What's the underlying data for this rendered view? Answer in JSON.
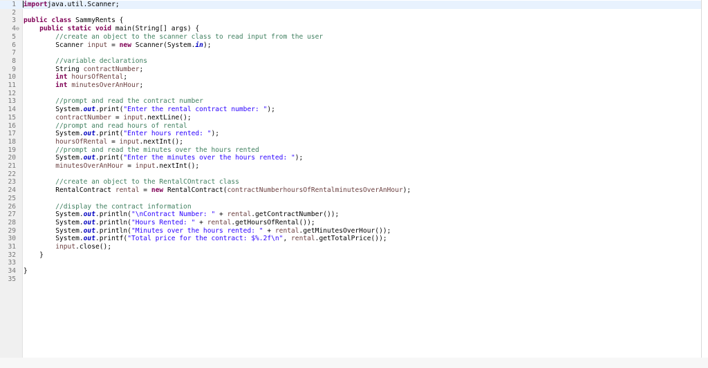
{
  "editor": {
    "lines": [
      {
        "n": "1",
        "tokens": [
          [
            "kw",
            "import"
          ],
          [
            "",
            "java.util.Scanner;"
          ]
        ]
      },
      {
        "n": "2",
        "tokens": []
      },
      {
        "n": "3",
        "tokens": [
          [
            "kw",
            "public"
          ],
          [
            "",
            " "
          ],
          [
            "kw",
            "class"
          ],
          [
            "",
            " SammyRents {"
          ]
        ]
      },
      {
        "n": "4",
        "fold": true,
        "tokens": [
          [
            "",
            "    "
          ],
          [
            "kw",
            "public"
          ],
          [
            "",
            " "
          ],
          [
            "kw",
            "static"
          ],
          [
            "",
            " "
          ],
          [
            "kw",
            "void"
          ],
          [
            "",
            " main(String[] args) {"
          ]
        ]
      },
      {
        "n": "5",
        "tokens": [
          [
            "",
            "        "
          ],
          [
            "cm",
            "//create an object to the scanner class to read input from the user"
          ]
        ]
      },
      {
        "n": "6",
        "tokens": [
          [
            "",
            "        Scanner "
          ],
          [
            "var",
            "input"
          ],
          [
            "",
            " = "
          ],
          [
            "kw",
            "new"
          ],
          [
            "",
            " Scanner(System."
          ],
          [
            "fd",
            "in"
          ],
          [
            "",
            ");"
          ]
        ]
      },
      {
        "n": "7",
        "tokens": []
      },
      {
        "n": "8",
        "tokens": [
          [
            "",
            "        "
          ],
          [
            "cm",
            "//variable declarations"
          ]
        ]
      },
      {
        "n": "9",
        "tokens": [
          [
            "",
            "        String "
          ],
          [
            "var",
            "contractNumber"
          ],
          [
            "",
            ";"
          ]
        ]
      },
      {
        "n": "10",
        "tokens": [
          [
            "",
            "        "
          ],
          [
            "kw",
            "int"
          ],
          [
            "",
            " "
          ],
          [
            "var",
            "hoursOfRental"
          ],
          [
            "",
            ";"
          ]
        ]
      },
      {
        "n": "11",
        "tokens": [
          [
            "",
            "        "
          ],
          [
            "kw",
            "int"
          ],
          [
            "",
            " "
          ],
          [
            "var",
            "minutesOverAnHour"
          ],
          [
            "",
            ";"
          ]
        ]
      },
      {
        "n": "12",
        "tokens": []
      },
      {
        "n": "13",
        "tokens": [
          [
            "",
            "        "
          ],
          [
            "cm",
            "//prompt and read the contract number"
          ]
        ]
      },
      {
        "n": "14",
        "tokens": [
          [
            "",
            "        System."
          ],
          [
            "fd",
            "out"
          ],
          [
            "",
            ".print("
          ],
          [
            "st",
            "\"Enter the rental contract number: \""
          ],
          [
            "",
            ");"
          ]
        ]
      },
      {
        "n": "15",
        "tokens": [
          [
            "",
            "        "
          ],
          [
            "var",
            "contractNumber"
          ],
          [
            "",
            " = "
          ],
          [
            "var",
            "input"
          ],
          [
            "",
            ".nextLine();"
          ]
        ]
      },
      {
        "n": "16",
        "tokens": [
          [
            "",
            "        "
          ],
          [
            "cm",
            "//prompt and read hours of rental"
          ]
        ]
      },
      {
        "n": "17",
        "tokens": [
          [
            "",
            "        System."
          ],
          [
            "fd",
            "out"
          ],
          [
            "",
            ".print("
          ],
          [
            "st",
            "\"Enter hours rented: \""
          ],
          [
            "",
            ");"
          ]
        ]
      },
      {
        "n": "18",
        "tokens": [
          [
            "",
            "        "
          ],
          [
            "var",
            "hoursOfRental"
          ],
          [
            "",
            " = "
          ],
          [
            "var",
            "input"
          ],
          [
            "",
            ".nextInt();"
          ]
        ]
      },
      {
        "n": "19",
        "tokens": [
          [
            "",
            "        "
          ],
          [
            "cm",
            "//prompt and read the minutes over the hours rented"
          ]
        ]
      },
      {
        "n": "20",
        "tokens": [
          [
            "",
            "        System."
          ],
          [
            "fd",
            "out"
          ],
          [
            "",
            ".print("
          ],
          [
            "st",
            "\"Enter the minutes over the hours rented: \""
          ],
          [
            "",
            ");"
          ]
        ]
      },
      {
        "n": "21",
        "tokens": [
          [
            "",
            "        "
          ],
          [
            "var",
            "minutesOverAnHour"
          ],
          [
            "",
            " = "
          ],
          [
            "var",
            "input"
          ],
          [
            "",
            ".nextInt();"
          ]
        ]
      },
      {
        "n": "22",
        "tokens": []
      },
      {
        "n": "23",
        "tokens": [
          [
            "",
            "        "
          ],
          [
            "cm",
            "//create an object to the RentalCOntract class"
          ]
        ]
      },
      {
        "n": "24",
        "tokens": [
          [
            "",
            "        RentalContract "
          ],
          [
            "var",
            "rental"
          ],
          [
            "",
            " = "
          ],
          [
            "kw",
            "new"
          ],
          [
            "",
            " RentalContract("
          ],
          [
            "var",
            "contractNumber"
          ],
          [
            ", "
          ],
          [
            "var",
            "hoursOfRental"
          ],
          [
            ", "
          ],
          [
            "var",
            "minutesOverAnHour"
          ],
          [
            "",
            ");"
          ]
        ]
      },
      {
        "n": "25",
        "tokens": []
      },
      {
        "n": "26",
        "tokens": [
          [
            "",
            "        "
          ],
          [
            "cm",
            "//display the contract information"
          ]
        ]
      },
      {
        "n": "27",
        "tokens": [
          [
            "",
            "        System."
          ],
          [
            "fd",
            "out"
          ],
          [
            "",
            ".println("
          ],
          [
            "st",
            "\"\\nContract Number: \""
          ],
          [
            "",
            " + "
          ],
          [
            "var",
            "rental"
          ],
          [
            "",
            ".getContractNumber());"
          ]
        ]
      },
      {
        "n": "28",
        "tokens": [
          [
            "",
            "        System."
          ],
          [
            "fd",
            "out"
          ],
          [
            "",
            ".println("
          ],
          [
            "st",
            "\"Hours Rented: \""
          ],
          [
            "",
            " + "
          ],
          [
            "var",
            "rental"
          ],
          [
            "",
            ".getHoursOfRental());"
          ]
        ]
      },
      {
        "n": "29",
        "tokens": [
          [
            "",
            "        System."
          ],
          [
            "fd",
            "out"
          ],
          [
            "",
            ".println("
          ],
          [
            "st",
            "\"Minutes over the hours rented: \""
          ],
          [
            "",
            " + "
          ],
          [
            "var",
            "rental"
          ],
          [
            "",
            ".getMinutesOverHour());"
          ]
        ]
      },
      {
        "n": "30",
        "tokens": [
          [
            "",
            "        System."
          ],
          [
            "fd",
            "out"
          ],
          [
            "",
            ".printf("
          ],
          [
            "st",
            "\"Total price for the contract: $%.2f\\n\""
          ],
          [
            "",
            ", "
          ],
          [
            "var",
            "rental"
          ],
          [
            "",
            ".getTotalPrice());"
          ]
        ]
      },
      {
        "n": "31",
        "tokens": [
          [
            "",
            "        "
          ],
          [
            "var",
            "input"
          ],
          [
            "",
            ".close();"
          ]
        ]
      },
      {
        "n": "32",
        "tokens": [
          [
            "",
            "    }"
          ]
        ]
      },
      {
        "n": "33",
        "tokens": []
      },
      {
        "n": "34",
        "tokens": [
          [
            "",
            "}"
          ]
        ]
      },
      {
        "n": "35",
        "tokens": []
      }
    ]
  }
}
